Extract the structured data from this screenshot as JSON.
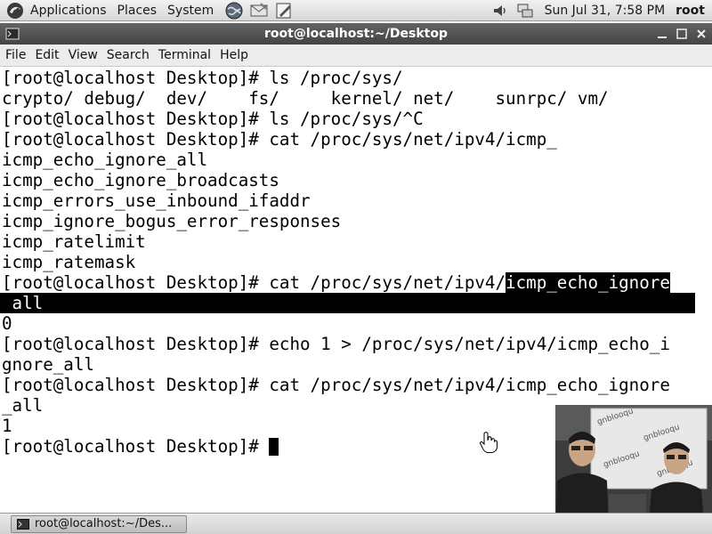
{
  "panel": {
    "applications": "Applications",
    "places": "Places",
    "system": "System",
    "clock": "Sun Jul 31,  7:58 PM",
    "user": "root"
  },
  "window": {
    "title": "root@localhost:~/Desktop"
  },
  "menubar": {
    "file": "File",
    "edit": "Edit",
    "view": "View",
    "search": "Search",
    "terminal": "Terminal",
    "help": "Help"
  },
  "terminal": {
    "lines": [
      "[root@localhost Desktop]# ls /proc/sys/",
      "crypto/ debug/  dev/    fs/     kernel/ net/    sunrpc/ vm/",
      "[root@localhost Desktop]# ls /proc/sys/^C",
      "[root@localhost Desktop]# cat /proc/sys/net/ipv4/icmp_",
      "icmp_echo_ignore_all",
      "icmp_echo_ignore_broadcasts",
      "icmp_errors_use_inbound_ifaddr",
      "icmp_ignore_bogus_error_responses",
      "icmp_ratelimit",
      "icmp_ratemask",
      "[root@localhost Desktop]# cat /proc/sys/net/ipv4/",
      "icmp_echo_ignore",
      " all",
      "0",
      "[root@localhost Desktop]# echo 1 > /proc/sys/net/ipv4/icmp_echo_i",
      "gnore_all",
      "[root@localhost Desktop]# cat /proc/sys/net/ipv4/icmp_echo_ignore",
      "_all",
      "1",
      "[root@localhost Desktop]# "
    ]
  },
  "taskbar": {
    "task_label": "root@localhost:~/Des..."
  },
  "webcam": {
    "banner_text": "gnblooqu"
  },
  "colors": {
    "panel_bg": "#e0e0e0",
    "titlebar_bg": "#505050",
    "terminal_bg": "#ffffff",
    "terminal_fg": "#000000",
    "selection_bg": "#000000"
  },
  "icons": [
    "distro-logo-icon",
    "globe-browser-icon",
    "mail-icon",
    "text-editor-icon",
    "volume-icon",
    "network-icon",
    "terminal-icon",
    "minimize-icon",
    "maximize-icon",
    "close-icon",
    "mouse-pointer-hand-icon"
  ]
}
